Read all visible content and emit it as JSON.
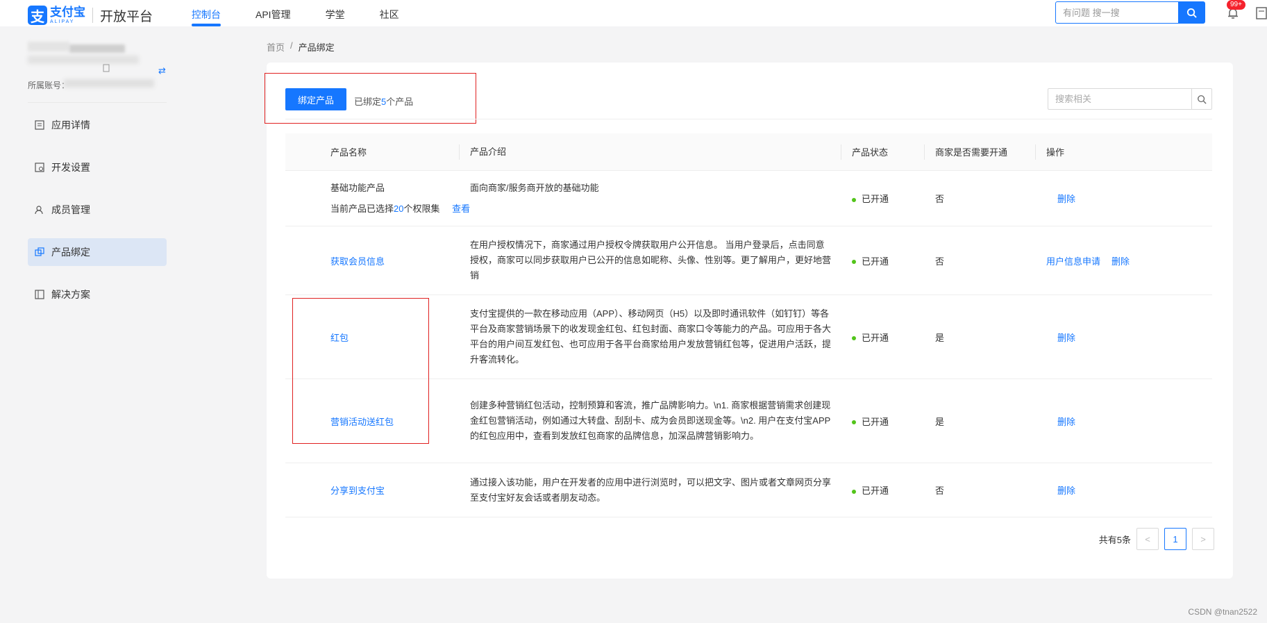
{
  "brand": {
    "logo_glyph": "支",
    "name": "支付宝",
    "sub": "ALIPAY",
    "product": "开放平台",
    "accent": "#1677ff"
  },
  "topnav": {
    "items": [
      {
        "label": "控制台",
        "active": true
      },
      {
        "label": "API管理",
        "active": false
      },
      {
        "label": "学堂",
        "active": false
      },
      {
        "label": "社区",
        "active": false
      }
    ]
  },
  "top_search": {
    "placeholder": "有问题 搜一搜"
  },
  "notifications": {
    "badge": "99+"
  },
  "account": {
    "label": "所属账号："
  },
  "sidebar": {
    "items": [
      {
        "label": "应用详情",
        "icon": "app-detail-icon",
        "active": false
      },
      {
        "label": "开发设置",
        "icon": "dev-settings-icon",
        "active": false
      },
      {
        "label": "成员管理",
        "icon": "members-icon",
        "active": false
      },
      {
        "label": "产品绑定",
        "icon": "product-bind-icon",
        "active": true
      },
      {
        "label": "解决方案",
        "icon": "solution-icon",
        "active": false
      }
    ]
  },
  "breadcrumb": {
    "home": "首页",
    "sep": "/",
    "current": "产品绑定"
  },
  "toolbar": {
    "bind_button": "绑定产品",
    "bound_prefix": "已绑定",
    "bound_count": "5",
    "bound_suffix": "个产品",
    "search_placeholder": "搜索相关"
  },
  "table": {
    "headers": [
      "产品名称",
      "产品介绍",
      "产品状态",
      "商家是否需要开通",
      "操作"
    ],
    "rows": [
      {
        "name": "基础功能产品",
        "name_link": false,
        "sub_prefix": "当前产品已选择",
        "sub_count": "20",
        "sub_suffix": "个权限集",
        "sub_link": "查看",
        "intro": "面向商家/服务商开放的基础功能",
        "status": "已开通",
        "need": "否",
        "ops": [
          "删除"
        ]
      },
      {
        "name": "获取会员信息",
        "name_link": true,
        "intro": "在用户授权情况下，商家通过用户授权令牌获取用户公开信息。 当用户登录后，点击同意授权，商家可以同步获取用户已公开的信息如昵称、头像、性别等。更了解用户，更好地营销",
        "status": "已开通",
        "need": "否",
        "ops": [
          "用户信息申请",
          "删除"
        ]
      },
      {
        "name": "红包",
        "name_link": true,
        "intro": "支付宝提供的一款在移动应用（APP）、移动网页（H5）以及即时通讯软件（如钉钉）等各平台及商家营销场景下的收发现金红包、红包封面、商家口令等能力的产品。可应用于各大平台的用户间互发红包、也可应用于各平台商家给用户发放营销红包等，促进用户活跃，提升客流转化。",
        "status": "已开通",
        "need": "是",
        "ops": [
          "删除"
        ]
      },
      {
        "name": "营销活动送红包",
        "name_link": true,
        "intro": "创建多种营销红包活动，控制预算和客流，推广品牌影响力。\\n1. 商家根据营销需求创建现金红包营销活动，例如通过大转盘、刮刮卡、成为会员即送现金等。\\n2. 用户在支付宝APP的红包应用中，查看到发放红包商家的品牌信息，加深品牌营销影响力。",
        "status": "已开通",
        "need": "是",
        "ops": [
          "删除"
        ]
      },
      {
        "name": "分享到支付宝",
        "name_link": true,
        "intro": "通过接入该功能，用户在开发者的应用中进行浏览时，可以把文字、图片或者文章网页分享至支付宝好友会话或者朋友动态。",
        "status": "已开通",
        "need": "否",
        "ops": [
          "删除"
        ]
      }
    ]
  },
  "pagination": {
    "total_text": "共有5条",
    "prev": "<",
    "page": "1",
    "next": ">"
  },
  "watermark": "CSDN @tnan2522"
}
